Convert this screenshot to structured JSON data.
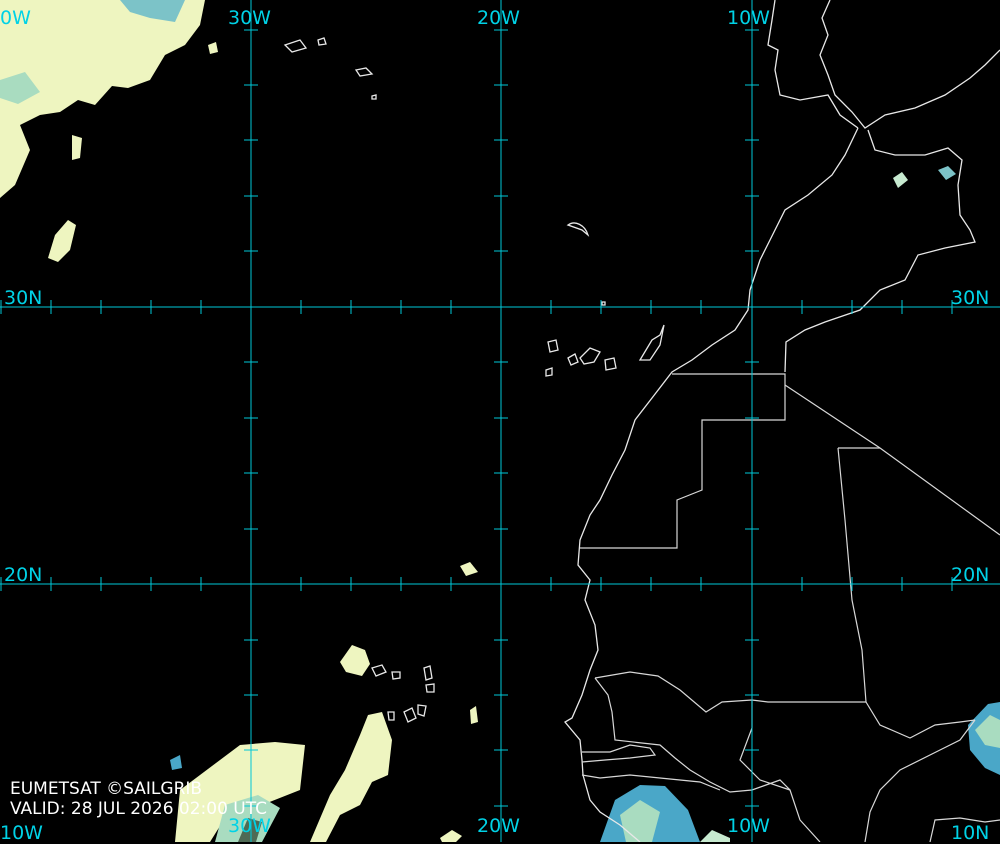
{
  "map": {
    "title": "",
    "colors": {
      "background": "#000000",
      "grid": "#00c8d8",
      "label": "#00d2e6",
      "coast": "#e8e8e8",
      "border": "#d8d8d8",
      "cloud_light": "#eef5c0",
      "cloud_mid": "#a9dcc0",
      "cloud_cold": "#4aa7c8"
    },
    "lon_labels_top": [
      "0W",
      "30W",
      "20W",
      "10W"
    ],
    "lon_labels_bottom": [
      "10W",
      "30W",
      "20W",
      "10W"
    ],
    "lat_labels_left": [
      "30N",
      "20N"
    ],
    "lat_labels_right": [
      "30N",
      "20N",
      "10N"
    ],
    "credit": "EUMETSAT ©SAILGRIB",
    "valid": "VALID:  28 JUL 2026 02:00 UTC"
  }
}
